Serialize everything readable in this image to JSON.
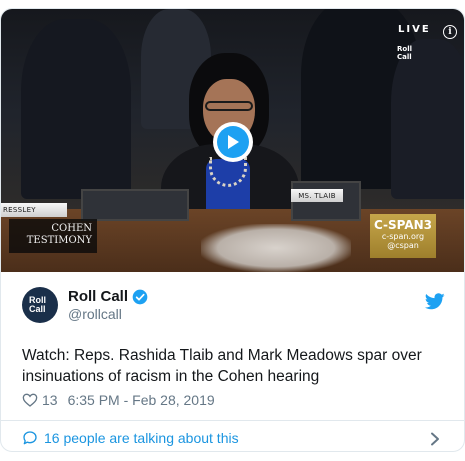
{
  "video": {
    "live_label": "LIVE",
    "watermark": "Roll Call",
    "nameplate_left": "RESSLEY",
    "nameplate_center": "MS. TLAIB",
    "lower_third": [
      "COHEN",
      "TESTIMONY"
    ],
    "network_logo": "C-SPAN3",
    "network_url": "c-span.org",
    "network_handle": "@cspan"
  },
  "tweet": {
    "avatar_text": "Roll Call",
    "display_name": "Roll Call",
    "handle": "@rollcall",
    "text": "Watch: Reps. Rashida Tlaib and Mark Meadows spar over insinuations of racism in the Cohen hearing",
    "like_count": "13",
    "timestamp": "6:35 PM - Feb 28, 2019",
    "talking_text": "16 people are talking about this"
  },
  "colors": {
    "accent": "#1da1f2",
    "link": "#1b95e0",
    "muted": "#657786",
    "text": "#14171a",
    "border": "#e1e8ed"
  },
  "icons": [
    "play-icon",
    "info-icon",
    "verified-icon",
    "twitter-bird-icon",
    "heart-icon",
    "speech-bubble-icon",
    "chevron-right-icon"
  ]
}
